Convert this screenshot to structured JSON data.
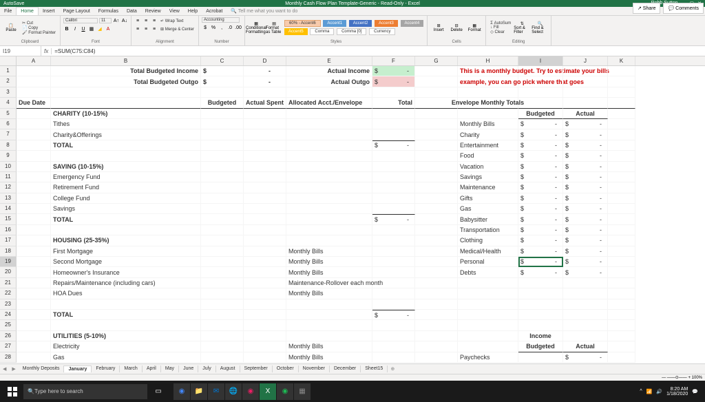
{
  "app": {
    "title_doc": "Monthly Cash Flow Plan Template-Generic",
    "title_mode": "Read-Only",
    "title_app": "Excel",
    "autosave": "AutoSave",
    "user": "Robb Sutton"
  },
  "menu": {
    "items": [
      "File",
      "Home",
      "Insert",
      "Page Layout",
      "Formulas",
      "Data",
      "Review",
      "View",
      "Help",
      "Acrobat"
    ],
    "active": "Home",
    "tellme": "Tell me what you want to do"
  },
  "ribbon": {
    "clipboard": {
      "label": "Clipboard",
      "paste": "Paste",
      "cut": "Cut",
      "copy": "Copy",
      "format_painter": "Format Painter"
    },
    "font": {
      "label": "Font",
      "name": "Calibri",
      "size": "11"
    },
    "alignment": {
      "label": "Alignment",
      "wrap": "Wrap Text",
      "merge": "Merge & Center"
    },
    "number": {
      "label": "Number",
      "format": "Accounting"
    },
    "styles": {
      "label": "Styles",
      "cond": "Conditional Formatting",
      "table": "Format as Table",
      "s0": "60% - Accent6",
      "s1": "Accent1",
      "s2": "Accent2",
      "s3": "Accent3",
      "s4": "Accent4",
      "s5": "Accent5",
      "comma": "Comma",
      "comma0": "Comma [0]",
      "currency": "Currency"
    },
    "cells": {
      "label": "Cells",
      "insert": "Insert",
      "delete": "Delete",
      "format": "Format"
    },
    "editing": {
      "label": "Editing",
      "autosum": "AutoSum",
      "fill": "Fill",
      "clear": "Clear",
      "sort": "Sort & Filter",
      "find": "Find & Select"
    },
    "share": "Share",
    "comments": "Comments"
  },
  "formula_bar": {
    "cell_ref": "I19",
    "formula": "=SUM(C75:C84)"
  },
  "cols": [
    "A",
    "B",
    "C",
    "D",
    "E",
    "F",
    "G",
    "H",
    "I",
    "J",
    "K"
  ],
  "sheet": {
    "r1": {
      "B": "Total Budgeted Income",
      "C": "$",
      "C2": "-",
      "E": "Actual Income",
      "F": "$",
      "F2": "-",
      "H": "This is a monthly budget. Try to estimate your bills"
    },
    "r2": {
      "B": "Total Budgeted Outgo",
      "C": "$",
      "C2": "-",
      "E": "Actual Outgo",
      "F": "$",
      "F2": "-",
      "H": "example, you can go pick where that goes"
    },
    "r4": {
      "A": "Due Date",
      "C": "Budgeted",
      "D": "Actual Spent",
      "E": "Allocated Acct./Envelope",
      "F": "Total",
      "H": "Envelope Monthly Totals"
    },
    "r5": {
      "B": "CHARITY (10-15%)",
      "I": "Budgeted",
      "J": "Actual"
    },
    "r6": {
      "B": "Tithes",
      "H": "Monthly Bills",
      "I": "$",
      "I2": "-",
      "J": "$",
      "J2": "-"
    },
    "r7": {
      "B": "Charity&Offerings",
      "H": "Charity",
      "I": "$",
      "I2": "-",
      "J": "$",
      "J2": "-"
    },
    "r8": {
      "B": "TOTAL",
      "F": "$",
      "F2": "-",
      "H": "Entertainment",
      "I": "$",
      "I2": "-",
      "J": "$",
      "J2": "-"
    },
    "r9": {
      "H": "Food",
      "I": "$",
      "I2": "-",
      "J": "$",
      "J2": "-"
    },
    "r10": {
      "B": "SAVING (10-15%)",
      "H": "Vacation",
      "I": "$",
      "I2": "-",
      "J": "$",
      "J2": "-"
    },
    "r11": {
      "B": "Emergency Fund",
      "H": "Savings",
      "I": "$",
      "I2": "-",
      "J": "$",
      "J2": "-"
    },
    "r12": {
      "B": "Retirement Fund",
      "H": "Maintenance",
      "I": "$",
      "I2": "-",
      "J": "$",
      "J2": "-"
    },
    "r13": {
      "B": "College Fund",
      "H": "Gifts",
      "I": "$",
      "I2": "-",
      "J": "$",
      "J2": "-"
    },
    "r14": {
      "B": "Savings",
      "H": "Gas",
      "I": "$",
      "I2": "-",
      "J": "$",
      "J2": "-"
    },
    "r15": {
      "B": "TOTAL",
      "F": "$",
      "F2": "-",
      "H": "Babysitter",
      "I": "$",
      "I2": "-",
      "J": "$",
      "J2": "-"
    },
    "r16": {
      "H": "Transportation",
      "I": "$",
      "I2": "-",
      "J": "$",
      "J2": "-"
    },
    "r17": {
      "B": "HOUSING (25-35%)",
      "H": "Clothing",
      "I": "$",
      "I2": "-",
      "J": "$",
      "J2": "-"
    },
    "r18": {
      "B": "First Mortgage",
      "E": "Monthly Bills",
      "H": "Medical/Health",
      "I": "$",
      "I2": "-",
      "J": "$",
      "J2": "-"
    },
    "r19": {
      "B": "Second Mortgage",
      "E": "Monthly Bills",
      "H": "Personal",
      "I": "$",
      "I2": "-",
      "J": "$",
      "J2": "-"
    },
    "r20": {
      "B": "Homeowner's Insurance",
      "E": "Monthly Bills",
      "H": "Debts",
      "I": "$",
      "I2": "-",
      "J": "$",
      "J2": "-"
    },
    "r21": {
      "B": "Repairs/Maintenance (including cars)",
      "E": "Maintenance-Rollover each month"
    },
    "r22": {
      "B": "HOA Dues",
      "E": "Monthly Bills"
    },
    "r24": {
      "B": "TOTAL",
      "F": "$",
      "F2": "-"
    },
    "r26": {
      "B": "UTILITIES (5-10%)",
      "I": "Income"
    },
    "r27": {
      "B": "Electricity",
      "E": "Monthly Bills",
      "I": "Budgeted",
      "J": "Actual"
    },
    "r28": {
      "B": "Gas",
      "E": "Monthly Bills",
      "H": "Paychecks",
      "J": "$",
      "J2": "-"
    }
  },
  "tabs": [
    "Monthly Deposits",
    "January",
    "February",
    "March",
    "April",
    "May",
    "June",
    "July",
    "August",
    "September",
    "October",
    "November",
    "December",
    "Sheet15"
  ],
  "tabs_active": "January",
  "taskbar": {
    "search": "Type here to search",
    "time": "8:20 AM",
    "date": "1/18/2020"
  }
}
